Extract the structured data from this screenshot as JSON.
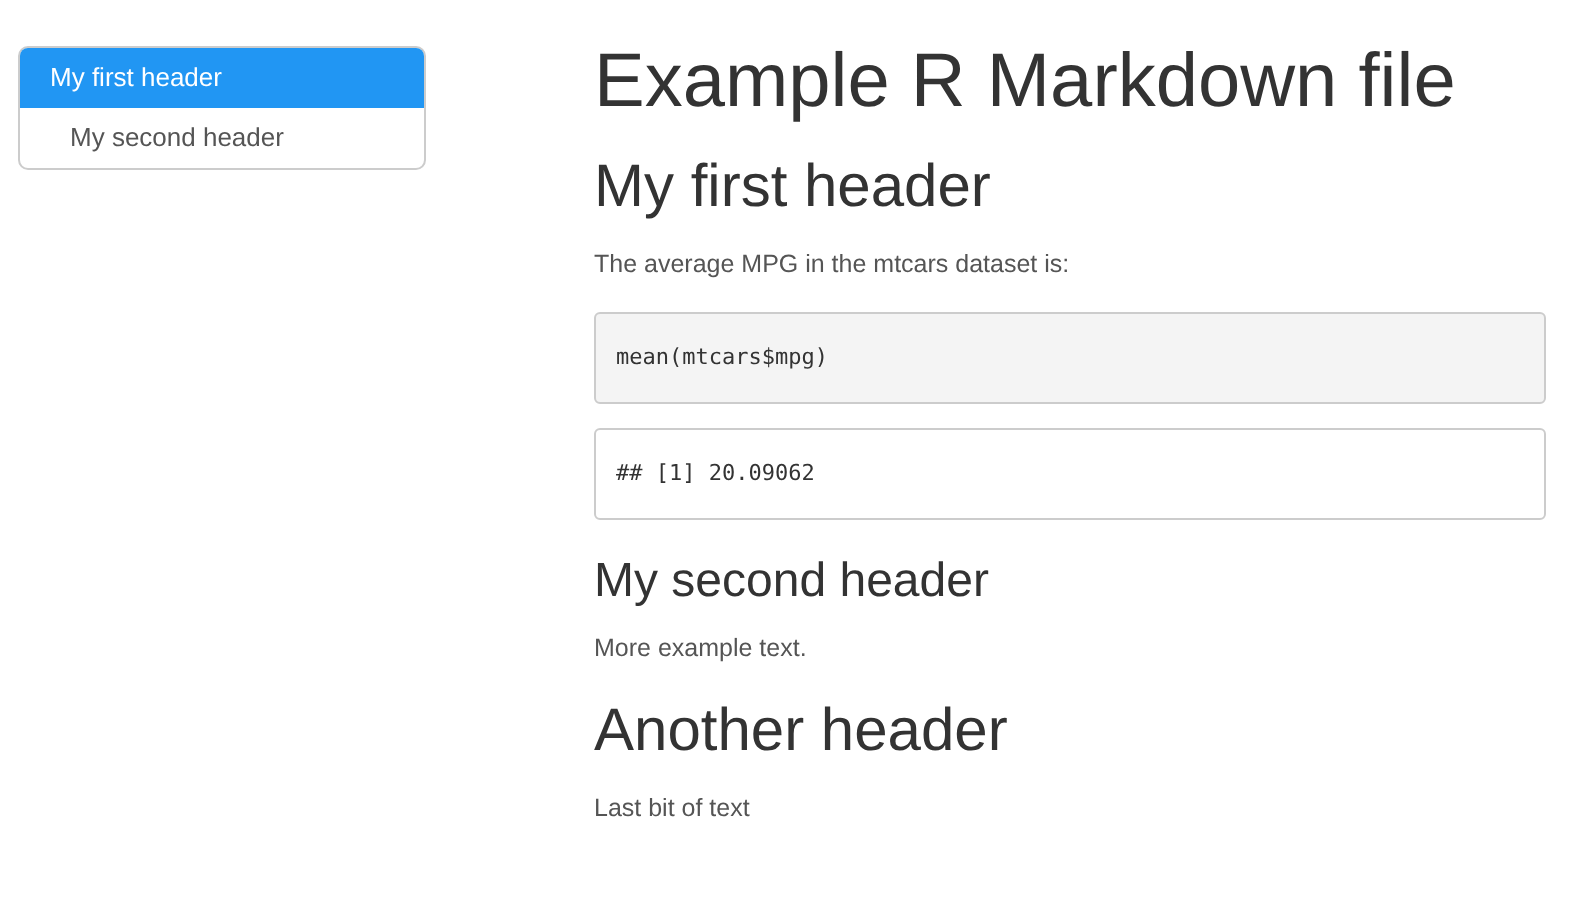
{
  "toc": [
    {
      "label": "My first header",
      "selected": true
    },
    {
      "label": "My second header",
      "selected": false
    }
  ],
  "title": "Example R Markdown file",
  "blocks": [
    {
      "kind": "h2",
      "text": "My first header"
    },
    {
      "kind": "p",
      "text": "The average MPG in the mtcars dataset is:"
    },
    {
      "kind": "code",
      "text": "mean(mtcars$mpg)"
    },
    {
      "kind": "output",
      "text": "## [1] 20.09062"
    },
    {
      "kind": "h3",
      "text": "My second header"
    },
    {
      "kind": "p",
      "text": "More example text."
    },
    {
      "kind": "h2",
      "text": "Another header"
    },
    {
      "kind": "p",
      "text": "Last bit of text"
    }
  ]
}
